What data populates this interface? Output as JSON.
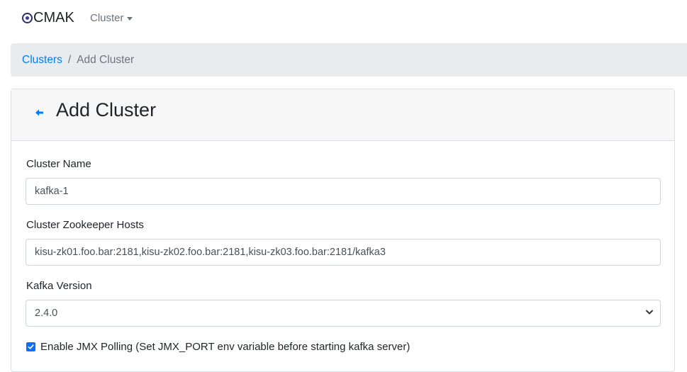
{
  "navbar": {
    "brand": "CMAK",
    "brand_icon": "cmak-logo-icon",
    "cluster_menu": "Cluster",
    "cluster_menu_icon": "caret-down-icon"
  },
  "breadcrumb": {
    "items": [
      "Clusters",
      "Add Cluster"
    ],
    "separator": "/"
  },
  "card": {
    "back_icon": "arrow-left-icon",
    "title": "Add Cluster"
  },
  "form": {
    "cluster_name": {
      "label": "Cluster Name",
      "value": "kafka-1"
    },
    "zk_hosts": {
      "label": "Cluster Zookeeper Hosts",
      "value": "kisu-zk01.foo.bar:2181,kisu-zk02.foo.bar:2181,kisu-zk03.foo.bar:2181/kafka3"
    },
    "kafka_version": {
      "label": "Kafka Version",
      "value": "2.4.0",
      "icon": "chevron-down-icon"
    },
    "jmx_polling": {
      "label": "Enable JMX Polling (Set JMX_PORT env variable before starting kafka server)",
      "checked": true
    }
  },
  "colors": {
    "link": "#007bff",
    "breadcrumb_bg": "#e9ecef",
    "card_header_bg": "#f7f7f7",
    "checkbox": "#0d6efd"
  }
}
